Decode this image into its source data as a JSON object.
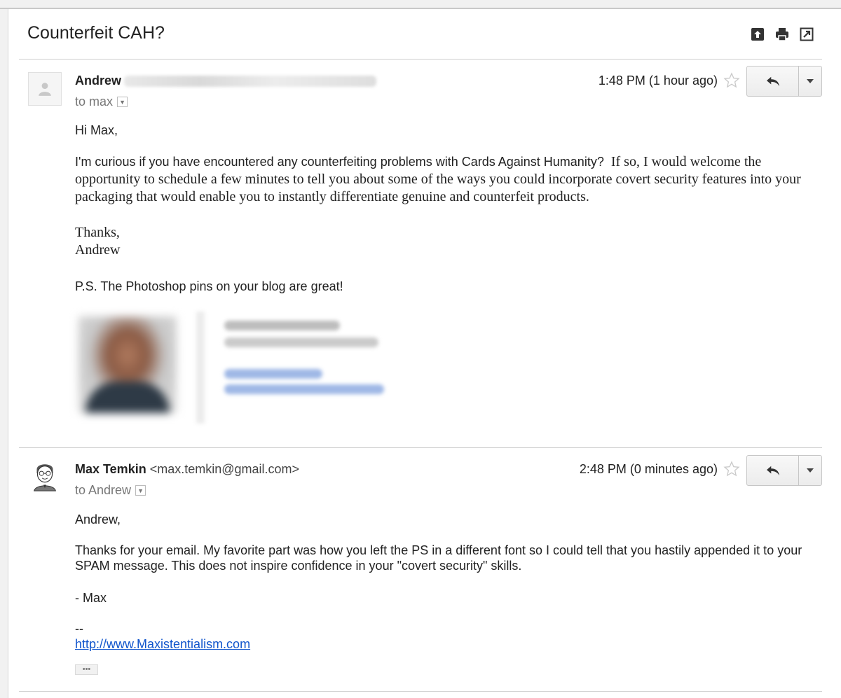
{
  "thread": {
    "subject": "Counterfeit CAH?"
  },
  "messages": [
    {
      "sender_name": "Andrew",
      "to_text": "to max",
      "time": "1:48 PM (1 hour ago)",
      "greeting": "Hi Max,",
      "para1_sans": "I'm curious if you have encountered any counterfeiting problems with Cards Against Humanity?",
      "para1_serif_line1": "If so, I would welcome",
      "para1_serif_rest": "the opportunity to schedule a few minutes to tell you about some of the ways you could incorporate covert security features into your packaging that would enable you to instantly differentiate genuine and counterfeit products.",
      "signoff_1": "Thanks,",
      "signoff_2": "Andrew",
      "ps": "P.S. The Photoshop pins on your blog are great!"
    },
    {
      "sender_name": "Max Temkin",
      "sender_email": "<max.temkin@gmail.com>",
      "to_text": "to Andrew",
      "time": "2:48 PM (0 minutes ago)",
      "greeting": "Andrew,",
      "paragraph": "Thanks for your email. My favorite part was how you left the PS in a different font so I could tell that you hastily appended it to your SPAM message. This does not inspire confidence in your \"covert security\" skills.",
      "signoff": "- Max",
      "sig_sep": "--",
      "sig_link": "http://www.Maxistentialism.com",
      "ellipsis": "•••"
    }
  ],
  "icons": {
    "toolbar": [
      "archive-icon",
      "print-icon",
      "popout-icon"
    ],
    "reply": "reply-arrow-icon",
    "star": "star-outline-icon",
    "more": "dropdown-triangle-icon"
  },
  "colors": {
    "link": "#1155cc",
    "divider": "#cfcfcf",
    "muted": "#777777"
  }
}
